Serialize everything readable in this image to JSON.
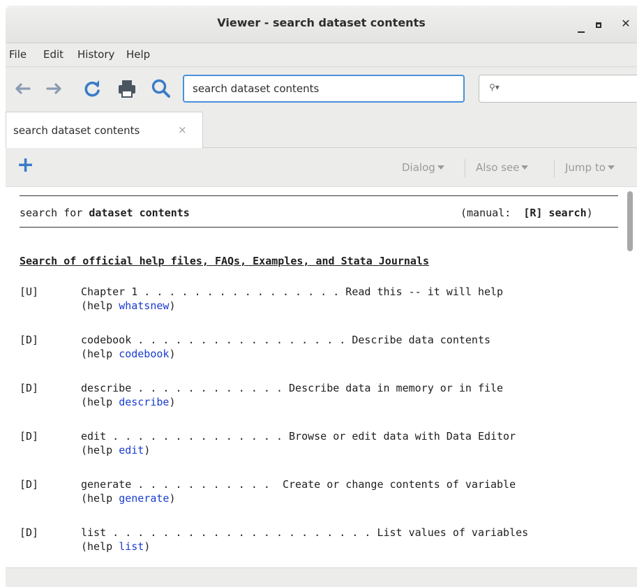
{
  "window": {
    "title": "Viewer - search dataset contents"
  },
  "menubar": {
    "items": [
      "File",
      "Edit",
      "History",
      "Help"
    ]
  },
  "toolbar": {
    "search_value": "search dataset contents",
    "find_placeholder": ""
  },
  "tabs": [
    {
      "label": "search dataset contents",
      "close": "×"
    }
  ],
  "viewbar": {
    "dialog": "Dialog",
    "also_see": "Also see",
    "jump_to": "Jump to"
  },
  "content": {
    "search_prefix": "search for ",
    "search_term": "dataset contents",
    "manual_prefix": "(manual:  ",
    "manual_ref": "[R] search",
    "manual_suffix": ")",
    "heading": "Search of official help files, FAQs, Examples, and Stata Journals",
    "entries": [
      {
        "tag": "[U]",
        "line": "Chapter 1 . . . . . . . . . . . . . . . . Read this -- it will help",
        "help_prefix": "(help ",
        "help_link": "whatsnew",
        "help_suffix": ")"
      },
      {
        "tag": "[D]",
        "line": "codebook . . . . . . . . . . . . . . . . . Describe data contents",
        "help_prefix": "(help ",
        "help_link": "codebook",
        "help_suffix": ")"
      },
      {
        "tag": "[D]",
        "line": "describe . . . . . . . . . . . . Describe data in memory or in file",
        "help_prefix": "(help ",
        "help_link": "describe",
        "help_suffix": ")"
      },
      {
        "tag": "[D]",
        "line": "edit . . . . . . . . . . . . . . Browse or edit data with Data Editor",
        "help_prefix": "(help ",
        "help_link": "edit",
        "help_suffix": ")"
      },
      {
        "tag": "[D]",
        "line": "generate . . . . . . . . . . .  Create or change contents of variable",
        "help_prefix": "(help ",
        "help_link": "generate",
        "help_suffix": ")"
      },
      {
        "tag": "[D]",
        "line": "list . . . . . . . . . . . . . . . . . . . . . List values of variables",
        "help_prefix": "(help ",
        "help_link": "list",
        "help_suffix": ")"
      }
    ]
  },
  "icons": {
    "back": "arrow-left-icon",
    "forward": "arrow-right-icon",
    "refresh": "refresh-icon",
    "print": "print-icon",
    "search": "search-icon"
  },
  "colors": {
    "accent": "#3a7bc8",
    "link": "#1a3ccf",
    "focus": "#4a90d9"
  }
}
